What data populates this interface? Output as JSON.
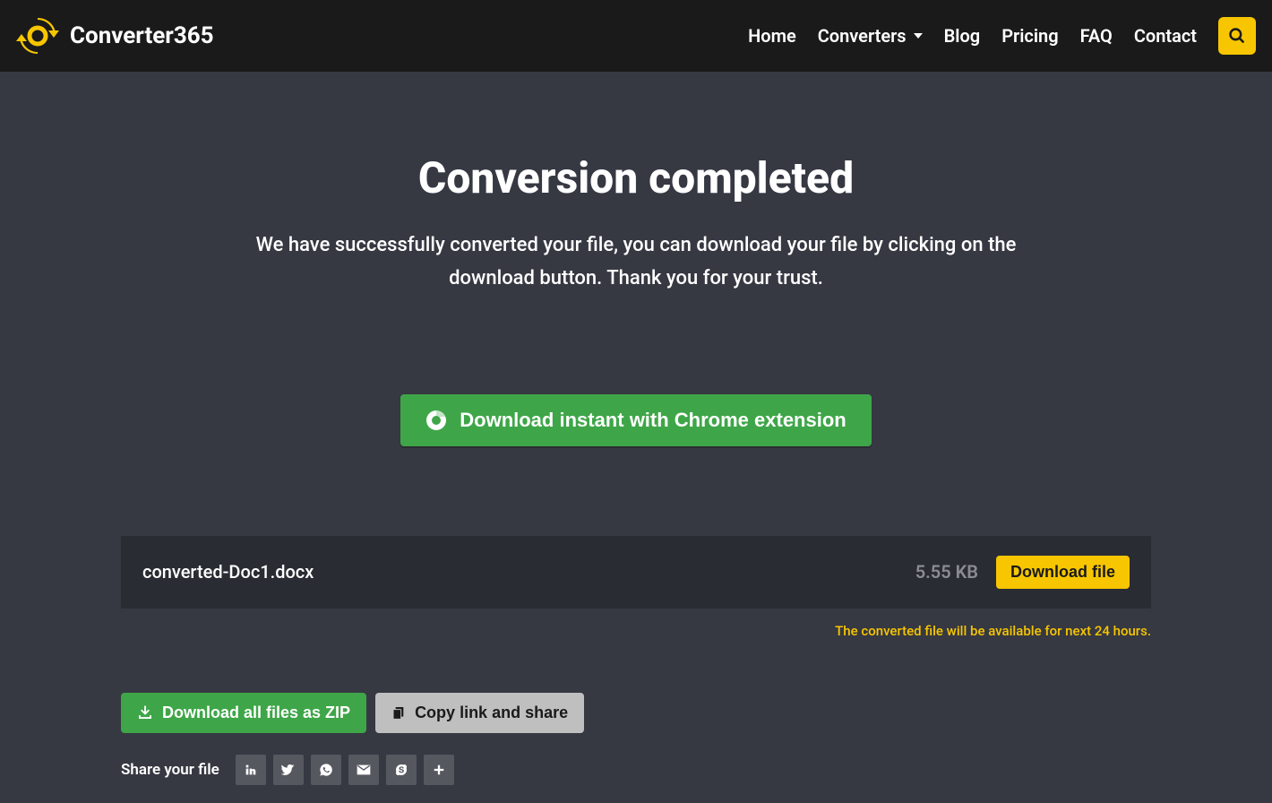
{
  "brand": "Converter365",
  "nav": {
    "home": "Home",
    "converters": "Converters",
    "blog": "Blog",
    "pricing": "Pricing",
    "faq": "FAQ",
    "contact": "Contact"
  },
  "main": {
    "title": "Conversion completed",
    "subtitle": "We have successfully converted your file, you can download your file by clicking on the download button. Thank you for your trust.",
    "chrome_button": "Download instant with Chrome extension"
  },
  "file": {
    "name": "converted-Doc1.docx",
    "size": "5.55 KB",
    "download_label": "Download file",
    "availability": "The converted file will be available for next 24 hours."
  },
  "actions": {
    "zip": "Download all files as ZIP",
    "copy": "Copy link and share"
  },
  "share": {
    "label": "Share your file"
  }
}
